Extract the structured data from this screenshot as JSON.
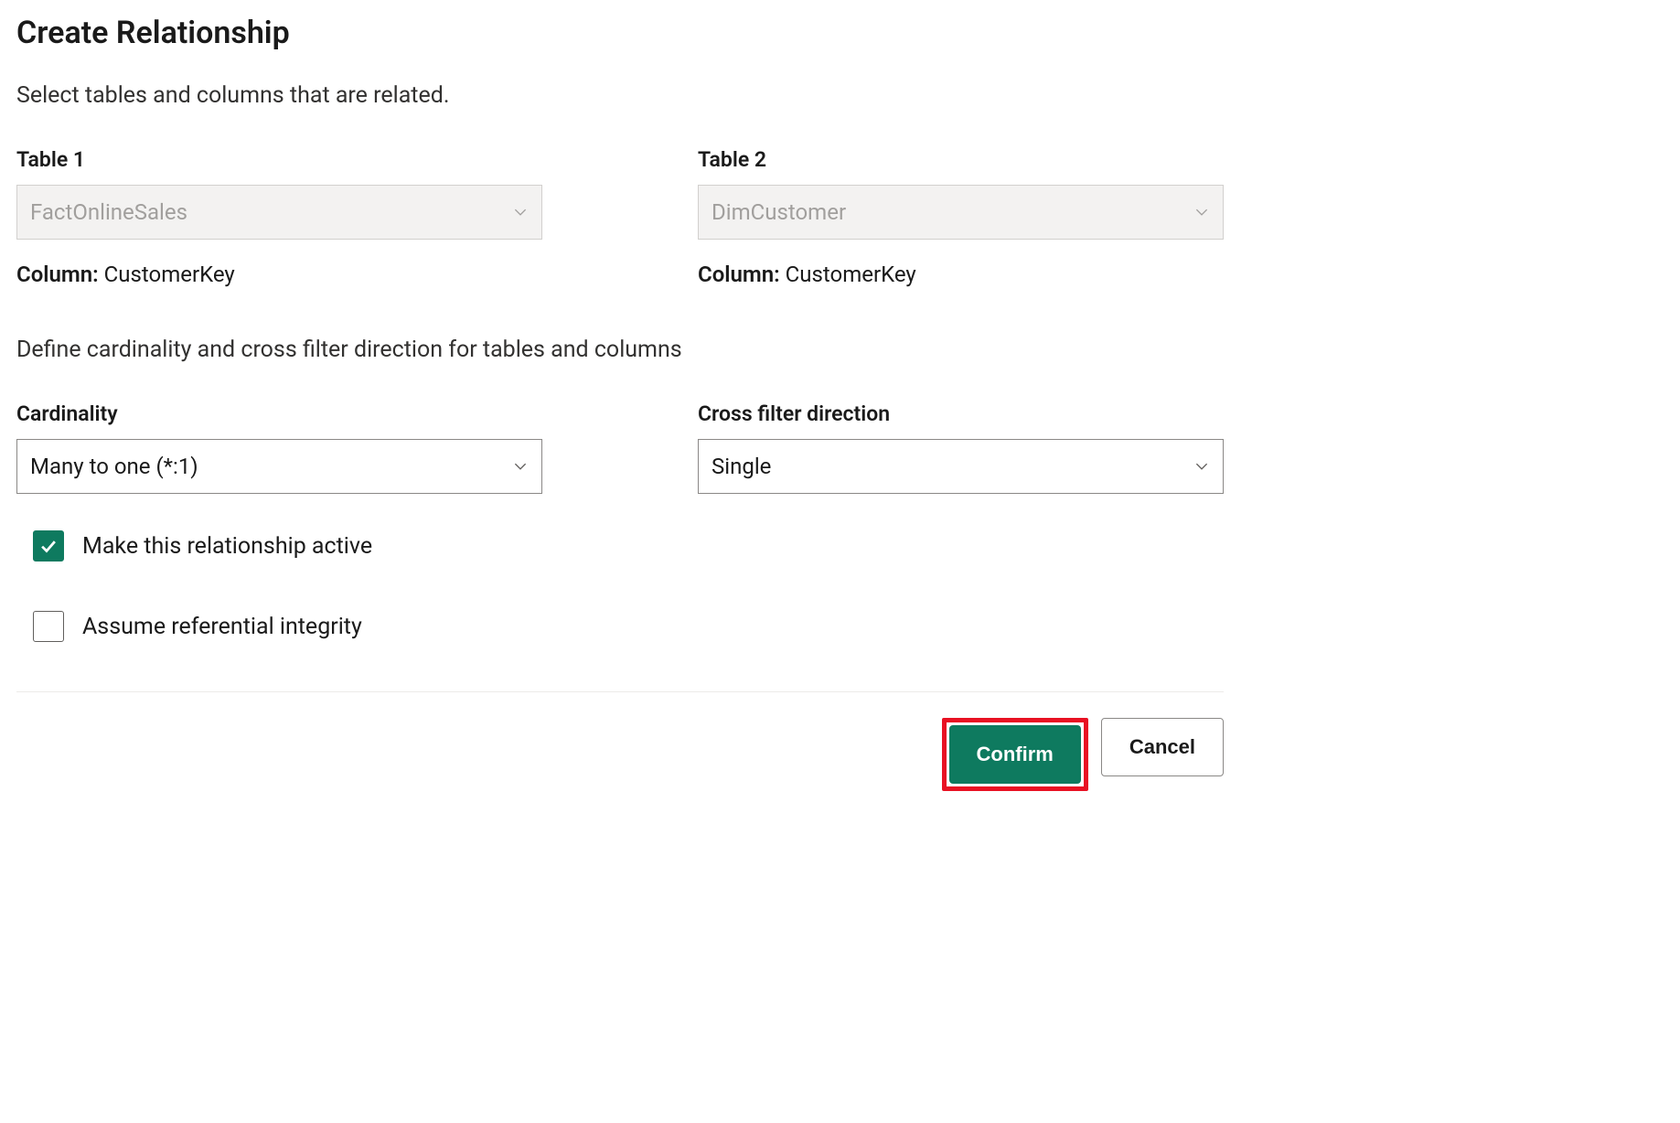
{
  "dialog": {
    "title": "Create Relationship",
    "instruction": "Select tables and columns that are related.",
    "section_instruction": "Define cardinality and cross filter direction for tables and columns"
  },
  "table1": {
    "label": "Table 1",
    "value": "FactOnlineSales",
    "column_label": "Column:",
    "column_value": "CustomerKey"
  },
  "table2": {
    "label": "Table 2",
    "value": "DimCustomer",
    "column_label": "Column:",
    "column_value": "CustomerKey"
  },
  "cardinality": {
    "label": "Cardinality",
    "value": "Many to one (*:1)"
  },
  "crossfilter": {
    "label": "Cross filter direction",
    "value": "Single"
  },
  "checkbox_active": {
    "label": "Make this relationship active",
    "checked": true
  },
  "checkbox_integrity": {
    "label": "Assume referential integrity",
    "checked": false
  },
  "buttons": {
    "confirm": "Confirm",
    "cancel": "Cancel"
  }
}
